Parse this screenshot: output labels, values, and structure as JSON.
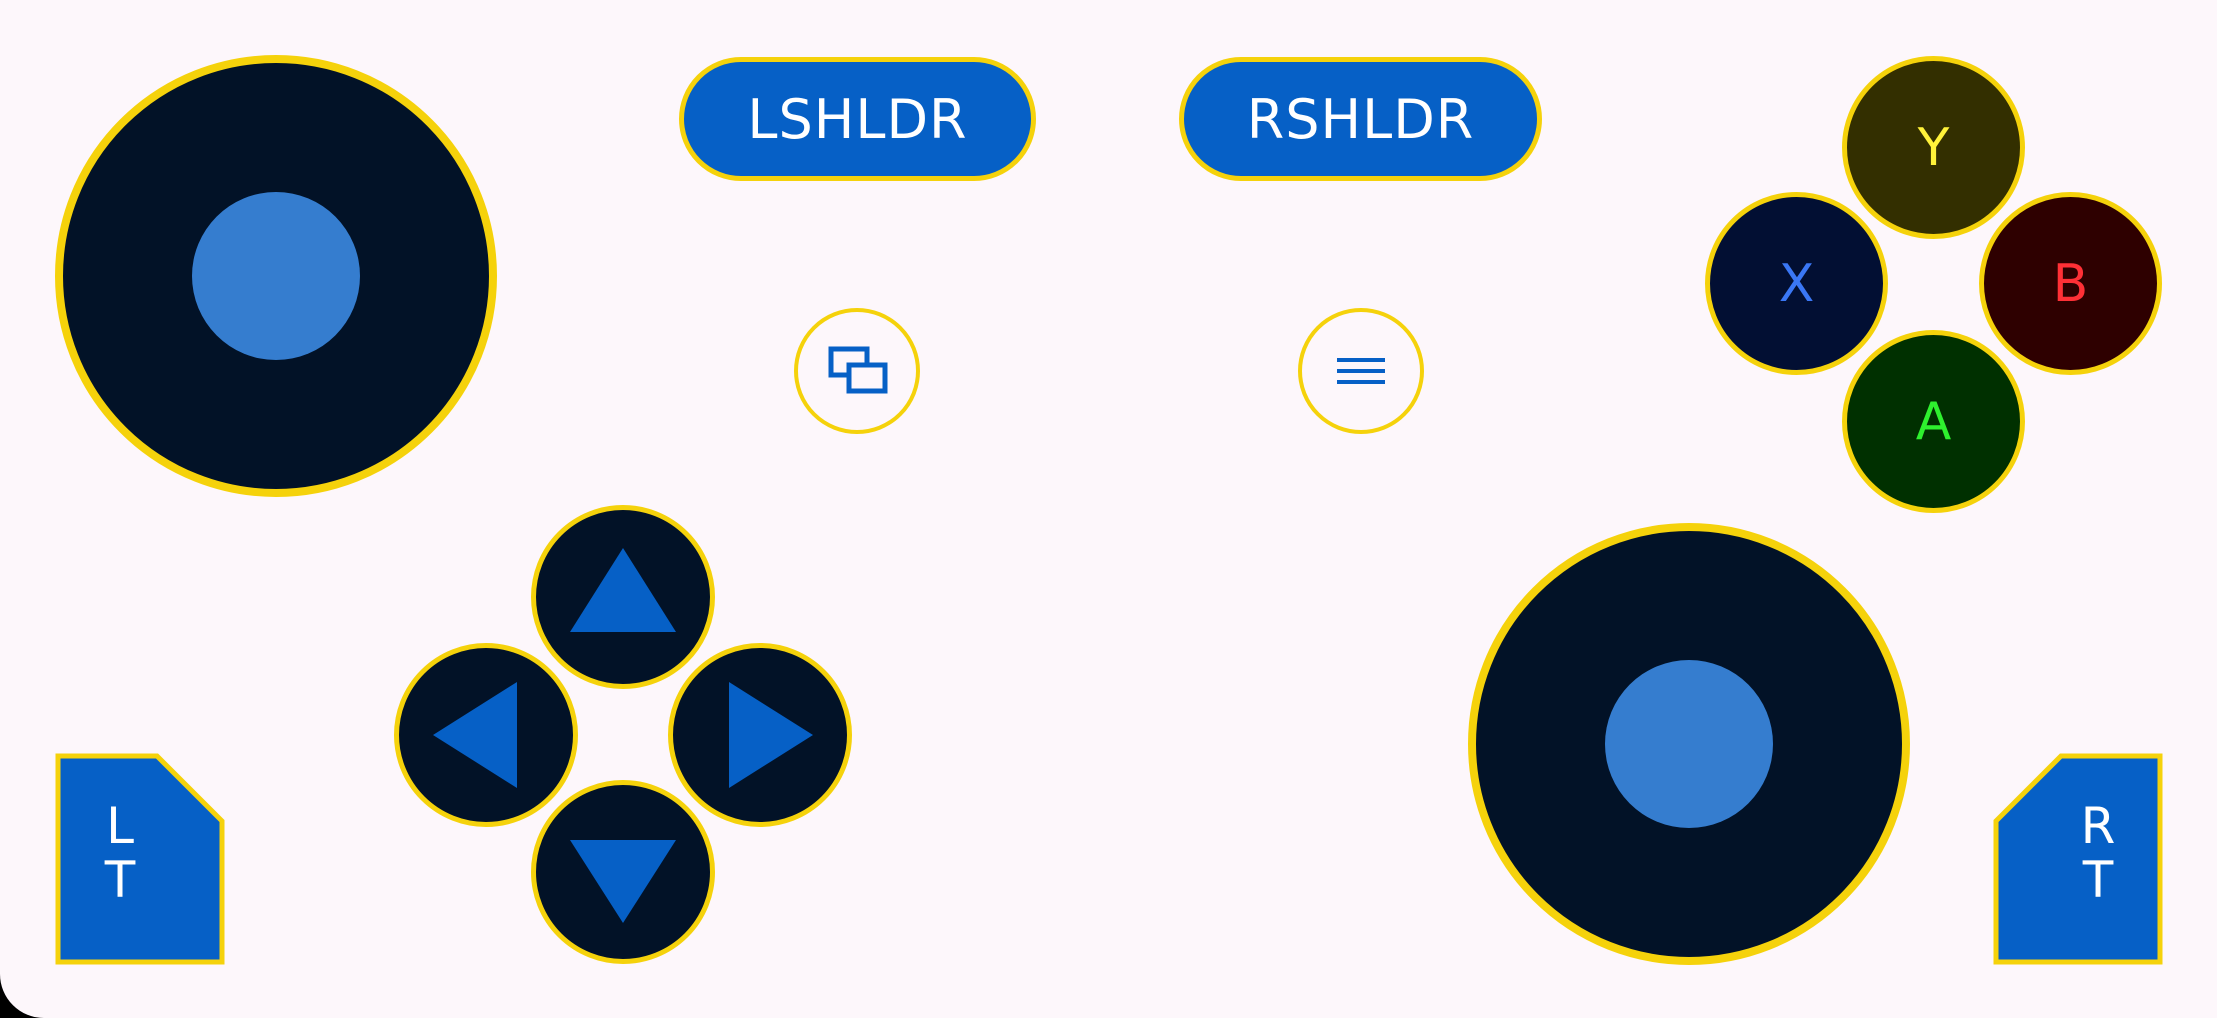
{
  "shoulders": {
    "left_label": "LSHLDR",
    "right_label": "RSHLDR"
  },
  "face_buttons": {
    "y": {
      "label": "Y",
      "text_color": "#fff23a",
      "bg": "#332f00"
    },
    "x": {
      "label": "X",
      "text_color": "#3a77f5",
      "bg": "#020f33"
    },
    "b": {
      "label": "B",
      "text_color": "#ff3036",
      "bg": "#2e0000"
    },
    "a": {
      "label": "A",
      "text_color": "#2ef02e",
      "bg": "#003000"
    }
  },
  "triggers": {
    "left": {
      "top": "L",
      "bottom": "T"
    },
    "right": {
      "top": "R",
      "bottom": "T"
    }
  },
  "icons": {
    "left_util": "screen-switch-icon",
    "right_util": "menu-icon",
    "dpad": [
      "up-arrow-icon",
      "left-arrow-icon",
      "right-arrow-icon",
      "down-arrow-icon"
    ]
  },
  "colors": {
    "background": "#fdf7fb",
    "accent_border": "#f5d20b",
    "control_blue": "#0660c6",
    "stick_base": "#021227",
    "stick_knob": "#357dcf"
  }
}
